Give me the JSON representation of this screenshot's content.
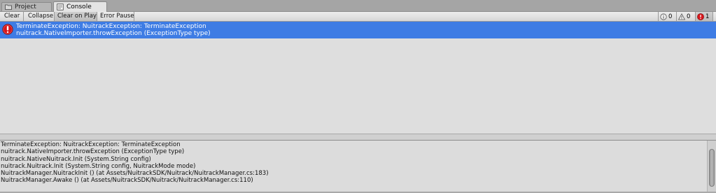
{
  "tabs": [
    {
      "label": "Project",
      "icon": "folder-icon",
      "active": false
    },
    {
      "label": "Console",
      "icon": "console-icon",
      "active": true
    }
  ],
  "toolbar": {
    "clear_label": "Clear",
    "collapse_label": "Collapse",
    "clear_on_play_label": "Clear on Play",
    "error_pause_label": "Error Pause"
  },
  "counters": {
    "info_count": "0",
    "warning_count": "0",
    "error_count": "1"
  },
  "log_entries": [
    {
      "type": "error",
      "line1": "TerminateException: NuitrackException: TerminateException",
      "line2": "nuitrack.NativeImporter.throwException (ExceptionType type)",
      "selected": true
    }
  ],
  "details": {
    "lines": [
      "TerminateException: NuitrackException: TerminateException",
      "nuitrack.NativeImporter.throwException (ExceptionType type)",
      "nuitrack.NativeNuitrack.Init (System.String config)",
      "nuitrack.Nuitrack.Init (System.String config, NuitrackMode mode)",
      "NuitrackManager.NuitrackInit () (at Assets/NuitrackSDK/Nuitrack/NuitrackManager.cs:183)",
      "NuitrackManager.Awake () (at Assets/NuitrackSDK/Nuitrack/NuitrackManager.cs:110)"
    ]
  },
  "colors": {
    "selection": "#3e7ce4",
    "error": "#d8161b"
  }
}
